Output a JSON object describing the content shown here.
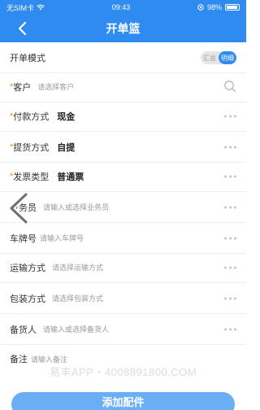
{
  "status": {
    "carrier": "无SIM卡",
    "time": "09:43",
    "battery": "98%"
  },
  "nav": {
    "title": "开单篮"
  },
  "mode": {
    "label": "开单模式",
    "options": [
      "汇总",
      "明细"
    ],
    "selected": "明细"
  },
  "fields": {
    "customer": {
      "label": "客户",
      "placeholder": "请选择客户"
    },
    "payment": {
      "label": "付款方式",
      "value": "现金"
    },
    "pickup": {
      "label": "提货方式",
      "value": "自提"
    },
    "invoice": {
      "label": "发票类型",
      "value": "普通票"
    },
    "salesman": {
      "label": "业务员",
      "placeholder": "请输入或选择业务员"
    },
    "plate": {
      "label": "车牌号",
      "placeholder": "请输入车牌号"
    },
    "transport": {
      "label": "运输方式",
      "placeholder": "请选择运输方式"
    },
    "packing": {
      "label": "包装方式",
      "placeholder": "请选择包装方式"
    },
    "stocker": {
      "label": "备货人",
      "placeholder": "请输入或选择备货人"
    },
    "remark": {
      "label": "备注",
      "placeholder": "请输入备注"
    }
  },
  "required_mark": "*",
  "watermark": "易丰APP・4008891800.COM",
  "add_button": "添加配件",
  "colors": {
    "primary": "#2f8bf0",
    "required": "#f08a1c"
  }
}
